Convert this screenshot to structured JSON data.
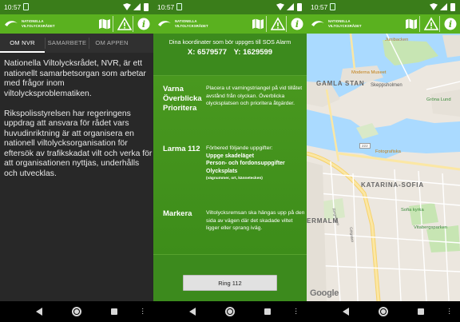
{
  "status_bar": {
    "time": "10:57"
  },
  "app": {
    "logo_line1": "NATIONELLA",
    "logo_line2": "VILTOLYCKSRÅDET",
    "icons": [
      "map-icon",
      "warning-icon",
      "info-icon"
    ]
  },
  "phone1": {
    "tabs": [
      "OM NVR",
      "SAMARBETE",
      "OM APPEN"
    ],
    "paragraph1": "Nationella Viltolycksrådet, NVR, är ett nationellt samarbetsorgan som arbetar med frågor inom viltolycksproblematiken.",
    "paragraph2": "Rikspolisstyrelsen har regeringens uppdrag att ansvara för rådet vars huvudinriktning är att organisera en nationell viltolycksorganisation för eftersök av trafikskadat vilt och verka för att organisationen nyttjas, underhålls och utvecklas."
  },
  "phone2": {
    "coord_intro": "Dina koordinater som bör uppges till SOS Alarm",
    "coord_x": "X: 6579577",
    "coord_y": "Y: 1629599",
    "steps": [
      {
        "head_lines": [
          "Varna",
          "Överblicka",
          "Prioritera"
        ],
        "text": "Placera ut varningstriangel på vid tillåtet avstånd från olyckan. Överblicka olycksplatsen och prioritera åtgärder."
      },
      {
        "head_lines": [
          "Larma 112"
        ],
        "text": "Förbered följande uppgifter:",
        "bold1": "Uppge skadeläget",
        "bold2": "Person- och fordonsuppgifter",
        "bold3": "Olycksplats",
        "small": "(vägnummer, ort, kännetecken)"
      },
      {
        "head_lines": [
          "Markera"
        ],
        "text": "Viltolycksremsan ska hängas upp på den sida av vägen där det skadade viltet ligger eller sprang iväg."
      }
    ],
    "button": "Ring 112"
  },
  "phone3": {
    "labels": {
      "junibacken": "Junibacken",
      "moderna": "Moderna Museet",
      "skeppsholmen": "Skeppsholmen",
      "gamla_stan": "GAMLA STAN",
      "grona_lund": "Gröna Lund",
      "fotografiska": "Fotografiska",
      "katarina_sofia": "KATARINA-SOFIA",
      "sofia_kyrka": "Sofia kyrka",
      "vitaberg": "Vitabergsparken",
      "ermalm": "ERMALM",
      "ringvagen": "Ringvägen",
      "gotgatan": "Götgatan",
      "road_222": "222",
      "google": "Google"
    }
  }
}
